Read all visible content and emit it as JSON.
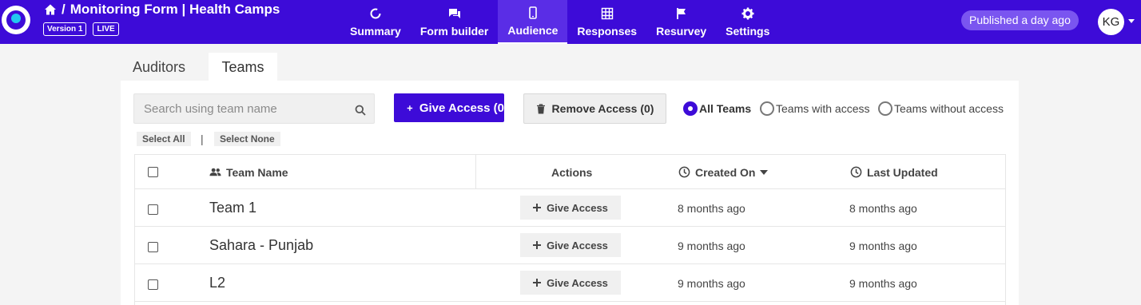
{
  "header": {
    "title": "Monitoring Form | Health Camps",
    "version_label": "Version 1",
    "live_label": "LIVE",
    "published_label": "Published a day ago",
    "avatar_initials": "KG",
    "brand_color": "#3d0bd8",
    "nav": [
      {
        "label": "Summary",
        "icon": "summary-ring-icon",
        "active": false
      },
      {
        "label": "Form builder",
        "icon": "chat-icon",
        "active": false
      },
      {
        "label": "Audience",
        "icon": "phone-icon",
        "active": true
      },
      {
        "label": "Responses",
        "icon": "grid-icon",
        "active": false
      },
      {
        "label": "Resurvey",
        "icon": "flag-icon",
        "active": false
      },
      {
        "label": "Settings",
        "icon": "gear-icon",
        "active": false
      }
    ]
  },
  "subtabs": {
    "auditors": "Auditors",
    "teams": "Teams",
    "active": "Teams"
  },
  "toolbar": {
    "search_placeholder": "Search using team name",
    "select_all": "Select All",
    "select_none": "Select None",
    "separator": "|",
    "give_access_label": "Give Access (0",
    "remove_access_label": "Remove Access (0)",
    "filters": [
      {
        "label": "All Teams",
        "checked": true
      },
      {
        "label": "Teams with access",
        "checked": false
      },
      {
        "label": "Teams without access",
        "checked": false
      }
    ]
  },
  "table": {
    "columns": {
      "team_name": "Team Name",
      "actions": "Actions",
      "created_on": "Created On",
      "last_updated": "Last Updated"
    },
    "sort": {
      "column": "Created On",
      "direction": "descending"
    },
    "rows": [
      {
        "name": "Team 1",
        "action": "Give Access",
        "created": "8 months ago",
        "updated": "8 months ago"
      },
      {
        "name": "Sahara - Punjab",
        "action": "Give Access",
        "created": "9 months ago",
        "updated": "9 months ago"
      },
      {
        "name": "L2",
        "action": "Give Access",
        "created": "9 months ago",
        "updated": "9 months ago"
      }
    ]
  }
}
